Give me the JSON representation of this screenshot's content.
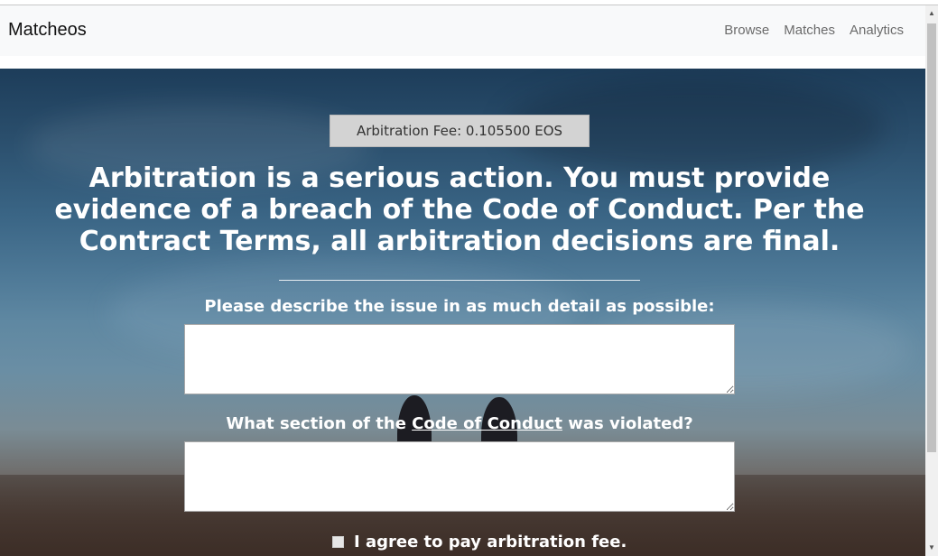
{
  "navbar": {
    "brand": "Matcheos",
    "links": [
      "Browse",
      "Matches",
      "Analytics"
    ]
  },
  "fee": {
    "label": "Arbitration Fee: 0.105500 EOS"
  },
  "warning": "Arbitration is a serious action. You must provide evidence of a breach of the Code of Conduct. Per the Contract Terms, all arbitration decisions are final.",
  "form": {
    "issue_label": "Please describe the issue in as much detail as possible:",
    "issue_value": "",
    "section_label_prefix": "What section of the ",
    "section_label_link": "Code of Conduct",
    "section_label_suffix": " was violated?",
    "section_value": "",
    "agree_label": "I agree to pay arbitration fee.",
    "agree_checked": false
  },
  "icons": {
    "scroll_up": "chevron-up-icon",
    "scroll_down": "chevron-down-icon"
  }
}
